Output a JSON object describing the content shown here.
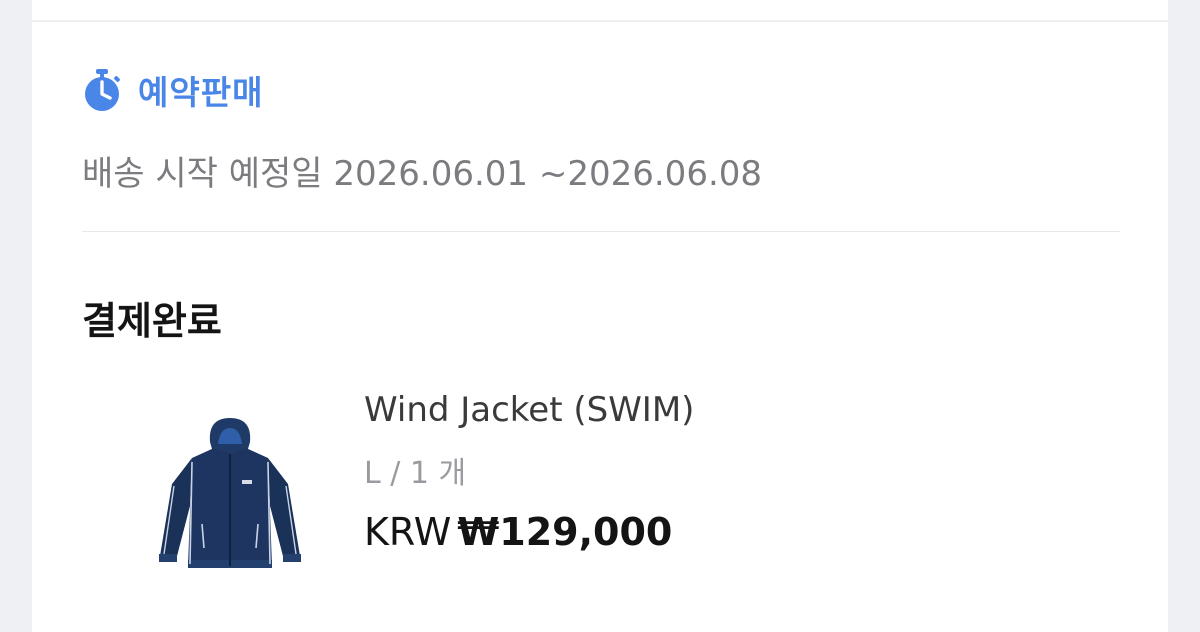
{
  "preorder": {
    "title": "예약판매",
    "shipping_text": "배송 시작 예정일 2026.06.01 ~2026.06.08",
    "icon": "timer-icon",
    "accent_color": "#4a86e8"
  },
  "order": {
    "status": "결제완료",
    "product": {
      "name": "Wind Jacket (SWIM)",
      "option": "L / 1 개",
      "currency": "KRW",
      "price": "₩129,000",
      "image": "navy-wind-jacket-image"
    }
  }
}
